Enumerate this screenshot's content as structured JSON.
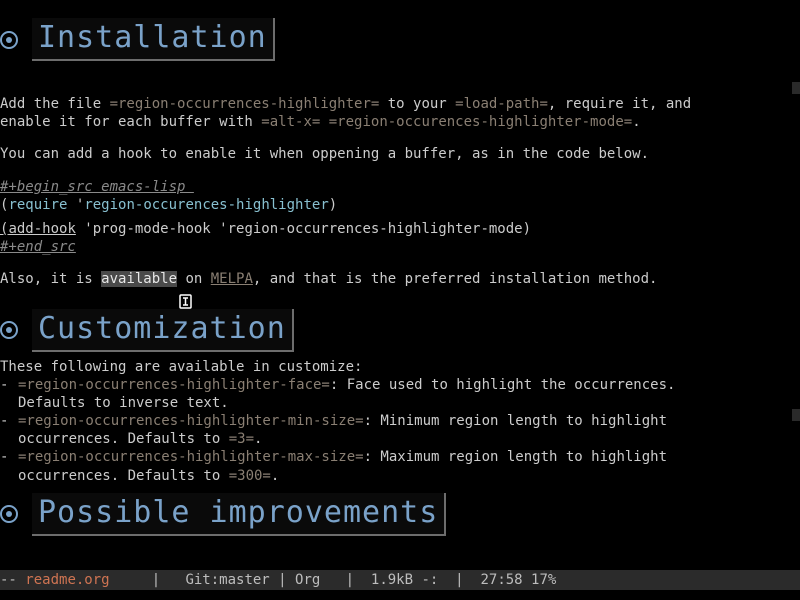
{
  "headings": {
    "installation": "Installation",
    "customization": "Customization",
    "improvements": "Possible improvements"
  },
  "body": {
    "add_file_1a": "Add the file ",
    "add_file_1b": "=region-occurrences-highlighter=",
    "add_file_1c": " to your ",
    "add_file_1d": "=load-path=",
    "add_file_1e": ", require it, and",
    "add_file_2a": "enable it for each buffer with ",
    "add_file_2b": "=alt-x=",
    "add_file_2c": " ",
    "add_file_2d": "=region-occurences-highlighter-mode=",
    "add_file_2e": ".",
    "hook": "You can add a hook to enable it when oppening a buffer, as in the code below.",
    "src_begin": "#+begin_src emacs-lisp ",
    "code_l1_open": "(",
    "code_l1_req": "require",
    "code_l1_sp": " '",
    "code_l1_sym": "region-occurences-highlighter",
    "code_l1_close": ")",
    "code_l2_open": "(",
    "code_l2_fn": "add-hook",
    "code_l2_rest": " 'prog-mode-hook 'region-occurrences-highlighter-mode)",
    "src_end": "#+end_src",
    "also_a": "Also, it is ",
    "also_sel": "available",
    "also_b": " on ",
    "also_link": "MELPA",
    "also_c": ", and that is the preferred installation method.",
    "custom_intro": "These following are available in customize:",
    "item1_a": "=region-occurrences-highlighter-face=",
    "item1_b": ": Face used to highlight the occurrences.",
    "item1_c": "Defaults to inverse text.",
    "item2_a": "=region-occurrences-highlighter-min-size=",
    "item2_b": ": Minimum region length to highlight",
    "item2_c_a": "occurrences. Defaults to ",
    "item2_c_b": "=3=",
    "item2_c_c": ".",
    "item3_a": "=region-occurrences-highlighter-max-size=",
    "item3_b": ": Maximum region length to highlight",
    "item3_c_a": "occurrences. Defaults to ",
    "item3_c_b": "=300=",
    "item3_c_c": "."
  },
  "modeline": {
    "left": "-- ",
    "file": "readme.org",
    "rest": "     |   Git:master | Org   |  1.9kB -:  |  27:58 17% "
  }
}
